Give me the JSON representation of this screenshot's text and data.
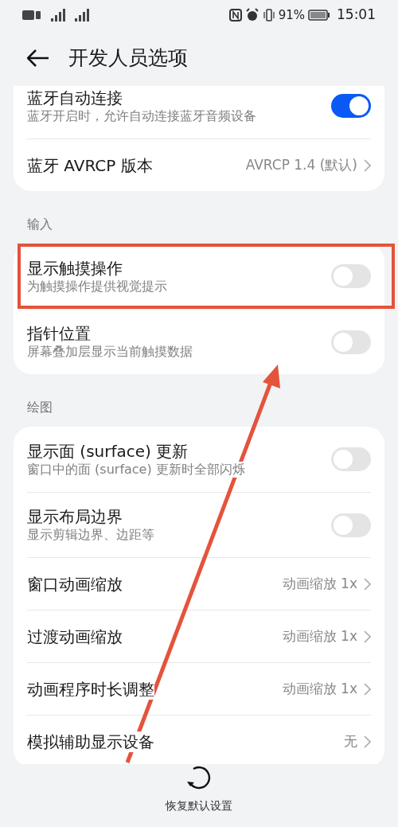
{
  "status_bar": {
    "battery": "91%",
    "time": "15:01"
  },
  "header": {
    "title": "开发人员选项"
  },
  "sections": [
    {
      "rows": [
        {
          "kind": "toggle",
          "title": "蓝牙自动连接",
          "subtitle": "蓝牙开启时，允许自动连接蓝牙音频设备",
          "on": true,
          "highlighted": false
        },
        {
          "kind": "value",
          "title": "蓝牙 AVRCP 版本",
          "value": "AVRCP 1.4 (默认)",
          "highlighted": false
        }
      ]
    },
    {
      "label": "输入",
      "rows": [
        {
          "kind": "toggle",
          "title": "显示触摸操作",
          "subtitle": "为触摸操作提供视觉提示",
          "on": false,
          "highlighted": true
        },
        {
          "kind": "toggle",
          "title": "指针位置",
          "subtitle": "屏幕叠加层显示当前触摸数据",
          "on": false,
          "highlighted": false
        }
      ]
    },
    {
      "label": "绘图",
      "rows": [
        {
          "kind": "toggle",
          "title": "显示面 (surface) 更新",
          "subtitle": "窗口中的面 (surface) 更新时全部闪烁",
          "on": false,
          "highlighted": false
        },
        {
          "kind": "toggle",
          "title": "显示布局边界",
          "subtitle": "显示剪辑边界、边距等",
          "on": false,
          "highlighted": false
        },
        {
          "kind": "value",
          "title": "窗口动画缩放",
          "value": "动画缩放 1x",
          "highlighted": false
        },
        {
          "kind": "value",
          "title": "过渡动画缩放",
          "value": "动画缩放 1x",
          "highlighted": false
        },
        {
          "kind": "value",
          "title": "动画程序时长调整",
          "value": "动画缩放 1x",
          "highlighted": false
        },
        {
          "kind": "value",
          "title": "模拟辅助显示设备",
          "value": "无",
          "highlighted": false
        }
      ]
    }
  ],
  "footer": {
    "label": "恢复默认设置"
  }
}
